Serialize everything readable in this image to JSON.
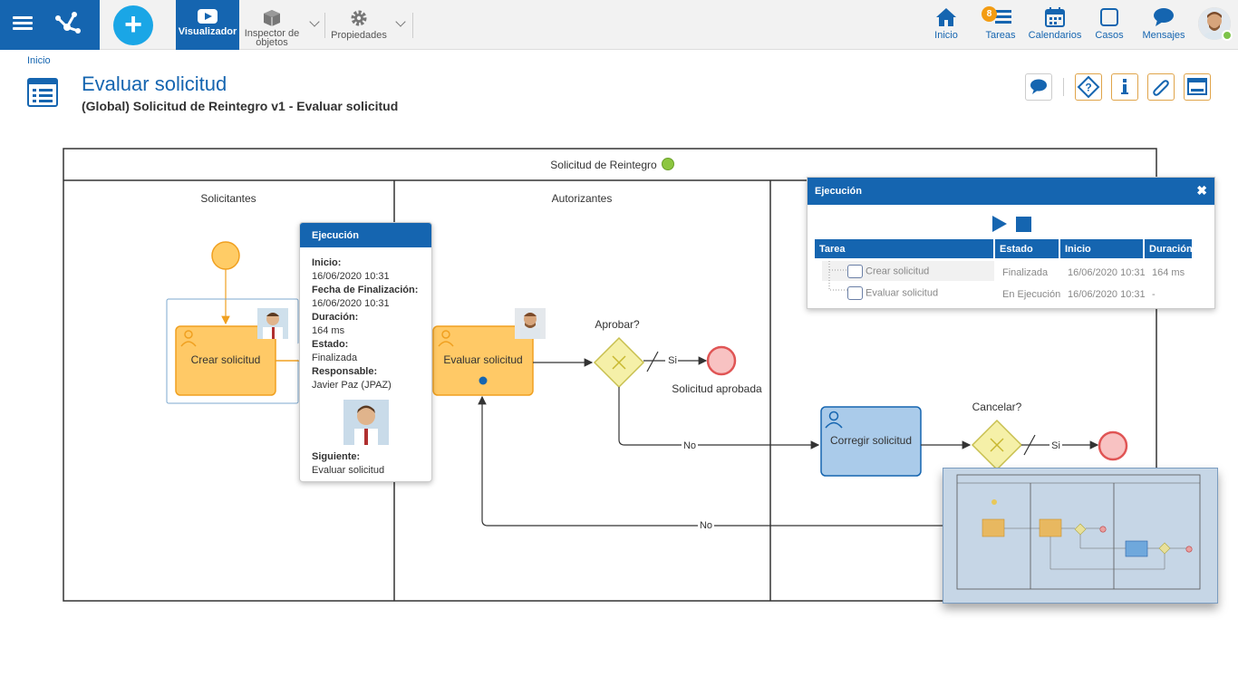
{
  "topbar": {
    "visualizador": "Visualizador",
    "inspector": "Inspector de objetos",
    "propiedades": "Propiedades",
    "inicio": "Inicio",
    "tareas": "Tareas",
    "tareas_badge": "8",
    "calendarios": "Calendarios",
    "casos": "Casos",
    "mensajes": "Mensajes"
  },
  "breadcrumb": "Inicio",
  "page": {
    "title": "Evaluar solicitud",
    "subtitle": "(Global) Solicitud de Reintegro v1 - Evaluar solicitud"
  },
  "diagram": {
    "pool": "Solicitud de Reintegro",
    "lanes": [
      "Solicitantes",
      "Autorizantes"
    ],
    "tasks": {
      "crear": "Crear solicitud",
      "evaluar": "Evaluar solicitud",
      "corregir": "Corregir solicitud"
    },
    "gateways": {
      "aprobar": "Aprobar?",
      "cancelar": "Cancelar?"
    },
    "labels": {
      "si1": "Si",
      "si2": "Si",
      "no1": "No",
      "no2": "No",
      "aprobada": "Solicitud aprobada"
    }
  },
  "tooltip": {
    "title": "Ejecución",
    "inicio_label": "Inicio:",
    "inicio": "16/06/2020 10:31",
    "fin_label": "Fecha de Finalización:",
    "fin": "16/06/2020 10:31",
    "duracion_label": "Duración:",
    "duracion": "164 ms",
    "estado_label": "Estado:",
    "estado": "Finalizada",
    "responsable_label": "Responsable:",
    "responsable": "Javier Paz (JPAZ)",
    "siguiente_label": "Siguiente:",
    "siguiente": "Evaluar solicitud"
  },
  "exec_panel": {
    "title": "Ejecución",
    "columns": [
      "Tarea",
      "Estado",
      "Inicio",
      "Duración"
    ],
    "rows": [
      {
        "tarea": "Crear solicitud",
        "estado": "Finalizada",
        "inicio": "16/06/2020 10:31",
        "duracion": "164 ms"
      },
      {
        "tarea": "Evaluar solicitud",
        "estado": "En Ejecución",
        "inicio": "16/06/2020 10:31",
        "duracion": "-"
      }
    ]
  },
  "colors": {
    "primary": "#1565b0",
    "accent": "#1aa6e6",
    "task_orange": "#ffc966",
    "task_blue": "#aacbea",
    "gateway": "#f5f0a8",
    "end_event": "#e05555"
  }
}
